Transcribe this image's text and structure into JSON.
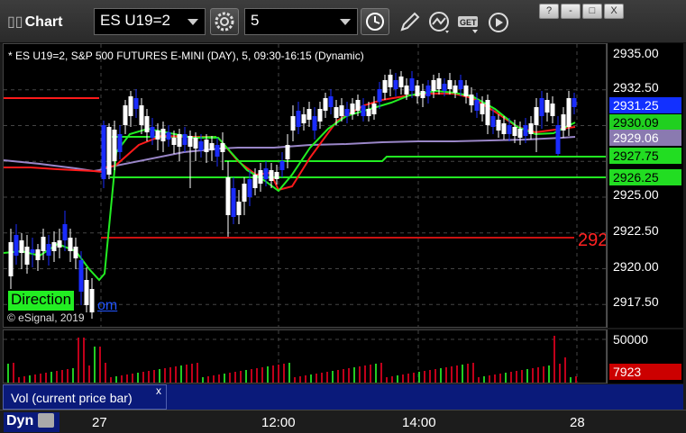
{
  "window": {
    "title": "Chart"
  },
  "toolbar": {
    "symbol": "ES U19=2",
    "interval": "5",
    "icons": [
      "settings-gear-icon",
      "clock-icon",
      "pencil-draw-icon",
      "study-icon",
      "get-icon",
      "play-icon"
    ]
  },
  "window_controls": [
    "?",
    "-",
    "□",
    "X"
  ],
  "chart": {
    "header": "* ES U19=2, S&P 500 FUTURES E-MINI (DAY), 5, 09:30-16:15 (Dynamic)",
    "watermark_text": "Direction",
    "watermark_suffix": "om",
    "copyright": "© eSignal, 2019",
    "right_overflow_label": "292",
    "price_labels": [
      "2935.00",
      "2932.50",
      "2925.00",
      "2922.50",
      "2920.00",
      "2917.50"
    ],
    "price_tags": [
      {
        "text": "2931.25",
        "bg": "#1230ff",
        "fg": "#ffffff"
      },
      {
        "text": "2930.09",
        "bg": "#20d020",
        "fg": "#000000"
      },
      {
        "text": "2929.06",
        "bg": "#8a7ab0",
        "fg": "#ffffff"
      },
      {
        "text": "2927.75",
        "bg": "#22dd22",
        "fg": "#000000"
      },
      {
        "text": "2926.25",
        "bg": "#22dd22",
        "fg": "#000000"
      }
    ]
  },
  "volume": {
    "axis_label": "50000",
    "current_tag": "7923",
    "study_label": "Vol (current price bar)",
    "close_label": "x"
  },
  "time_axis": {
    "mode": "Dyn",
    "labels": [
      "27",
      "12:00",
      "14:00",
      "28"
    ]
  },
  "colors": {
    "up_candle": "#ffffff",
    "down_candle": "#1a2cff",
    "red_line": "#ff1a1a",
    "green_line": "#22ee22",
    "purple_line": "#9a86c8",
    "vol_bar": "#c0001a"
  }
}
